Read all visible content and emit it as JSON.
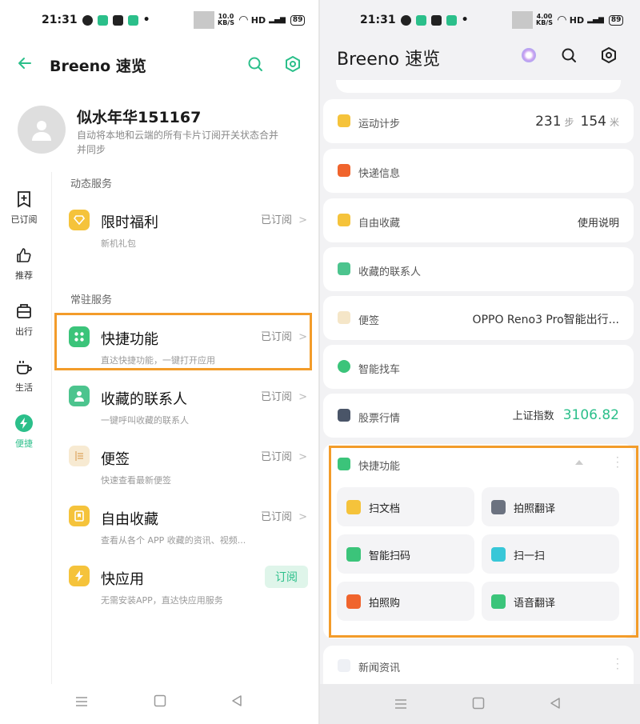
{
  "left": {
    "status": {
      "time": "21:31",
      "speed_top": "10.0",
      "speed_bottom": "KB/S",
      "network": "HD",
      "battery": "89"
    },
    "header": {
      "title": "Breeno 速览"
    },
    "profile": {
      "name": "似水年华151167",
      "desc_line1": "自动将本地和云端的所有卡片订阅开关状态合并",
      "desc_line2": "并同步"
    },
    "sidebar": [
      {
        "label": "已订阅"
      },
      {
        "label": "推荐"
      },
      {
        "label": "出行"
      },
      {
        "label": "生活"
      },
      {
        "label": "便捷"
      }
    ],
    "sections": {
      "dynamic": "动态服务",
      "resident": "常驻服务"
    },
    "services": [
      {
        "title": "限时福利",
        "sub": "新机礼包",
        "status": "已订阅",
        "color": "#f5c33b"
      },
      {
        "title": "快捷功能",
        "sub": "直达快捷功能，一键打开应用",
        "status": "已订阅",
        "color": "#3bc47a"
      },
      {
        "title": "收藏的联系人",
        "sub": "一键呼叫收藏的联系人",
        "status": "已订阅",
        "color": "#4cc48e"
      },
      {
        "title": "便签",
        "sub": "快速查看最新便签",
        "status": "已订阅",
        "color": "#f5e6c8"
      },
      {
        "title": "自由收藏",
        "sub": "查看从各个 APP 收藏的资讯、视频...",
        "status": "已订阅",
        "color": "#f5c33b"
      },
      {
        "title": "快应用",
        "sub": "无需安装APP，直达快应用服务",
        "status": "订阅",
        "color": "#f5c33b"
      }
    ]
  },
  "right": {
    "status": {
      "time": "21:31",
      "speed_top": "4.00",
      "speed_bottom": "KB/S",
      "network": "HD",
      "battery": "89"
    },
    "header": {
      "title": "Breeno 速览"
    },
    "cards": [
      {
        "label": "运动计步",
        "steps": "231",
        "steps_unit": "步",
        "meters": "154",
        "meters_unit": "米",
        "color": "#f5c33b"
      },
      {
        "label": "快递信息",
        "color": "#f0642d"
      },
      {
        "label": "自由收藏",
        "right": "使用说明",
        "color": "#f5c33b"
      },
      {
        "label": "收藏的联系人",
        "color": "#4cc48e"
      },
      {
        "label": "便签",
        "right": "OPPO Reno3 Pro智能出行...",
        "color": "#f5e6c8"
      },
      {
        "label": "智能找车",
        "color": "#3bc47a"
      },
      {
        "label": "股票行情",
        "right": "上证指数",
        "value": "3106.82",
        "color": "#4a5568"
      }
    ],
    "quick": {
      "label": "快捷功能",
      "items": [
        {
          "label": "扫文档",
          "color": "#f5c33b"
        },
        {
          "label": "拍照翻译",
          "color": "#6b7280"
        },
        {
          "label": "智能扫码",
          "color": "#3bc47a"
        },
        {
          "label": "扫一扫",
          "color": "#38c7d8"
        },
        {
          "label": "拍照购",
          "color": "#f0642d"
        },
        {
          "label": "语音翻译",
          "color": "#3bc47a"
        }
      ]
    },
    "news": {
      "label": "新闻资讯"
    }
  },
  "colors": {
    "accent": "#2bbf8a",
    "highlight": "#f39c2a"
  }
}
